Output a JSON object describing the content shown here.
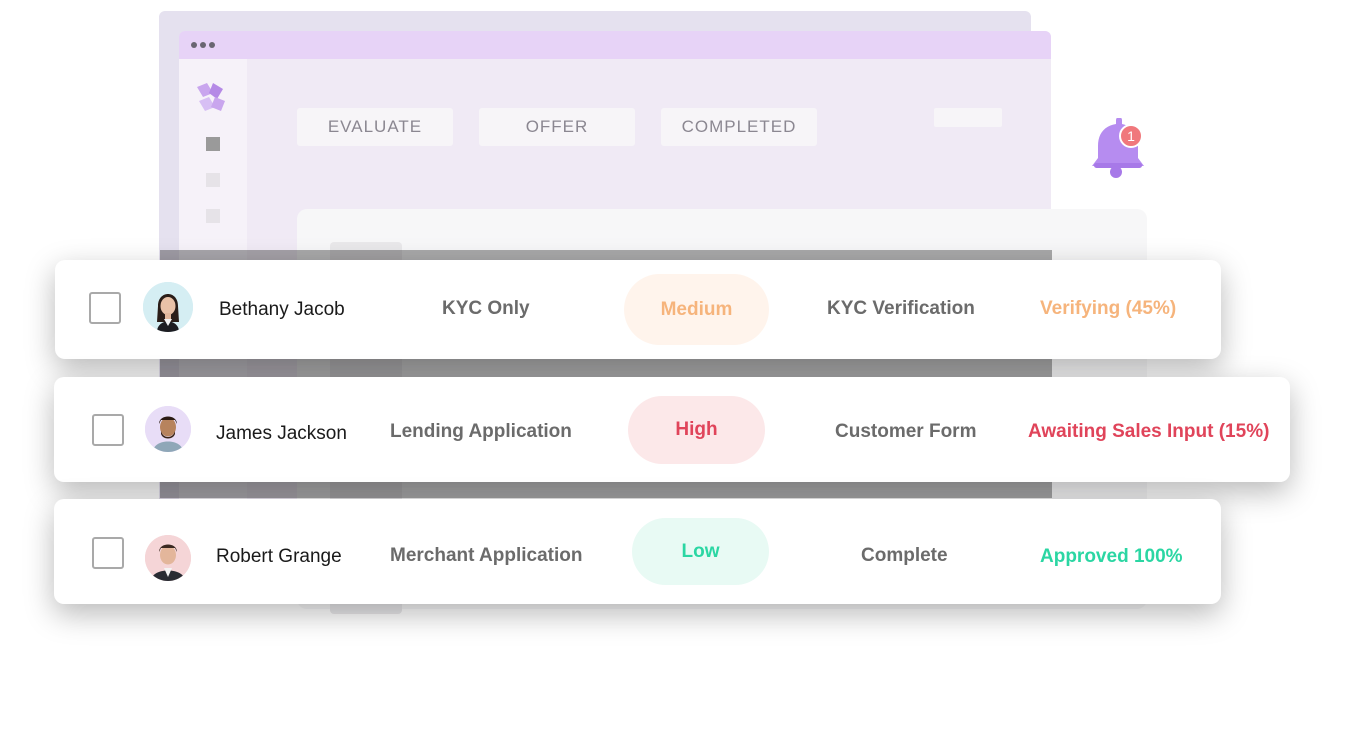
{
  "window": {
    "tabs": [
      "EVALUATE",
      "OFFER",
      "COMPLETED"
    ]
  },
  "notification": {
    "count": "1"
  },
  "colors": {
    "medium_bg": "#fff4ec",
    "medium_fg": "#f6b47c",
    "high_bg": "#fce8e9",
    "high_fg": "#e0445a",
    "low_bg": "#e8faf4",
    "low_fg": "#2bd6a3"
  },
  "rows": [
    {
      "name": "Bethany Jacob",
      "type": "KYC Only",
      "priority": "Medium",
      "step": "KYC Verification",
      "status": "Verifying (45%)",
      "progress": 45
    },
    {
      "name": "James Jackson",
      "type": "Lending Application",
      "priority": "High",
      "step": "Customer Form",
      "status": "Awaiting Sales Input (15%)",
      "progress": 15
    },
    {
      "name": "Robert Grange",
      "type": "Merchant Application",
      "priority": "Low",
      "step": "Complete",
      "status": "Approved 100%",
      "progress": 100
    }
  ]
}
